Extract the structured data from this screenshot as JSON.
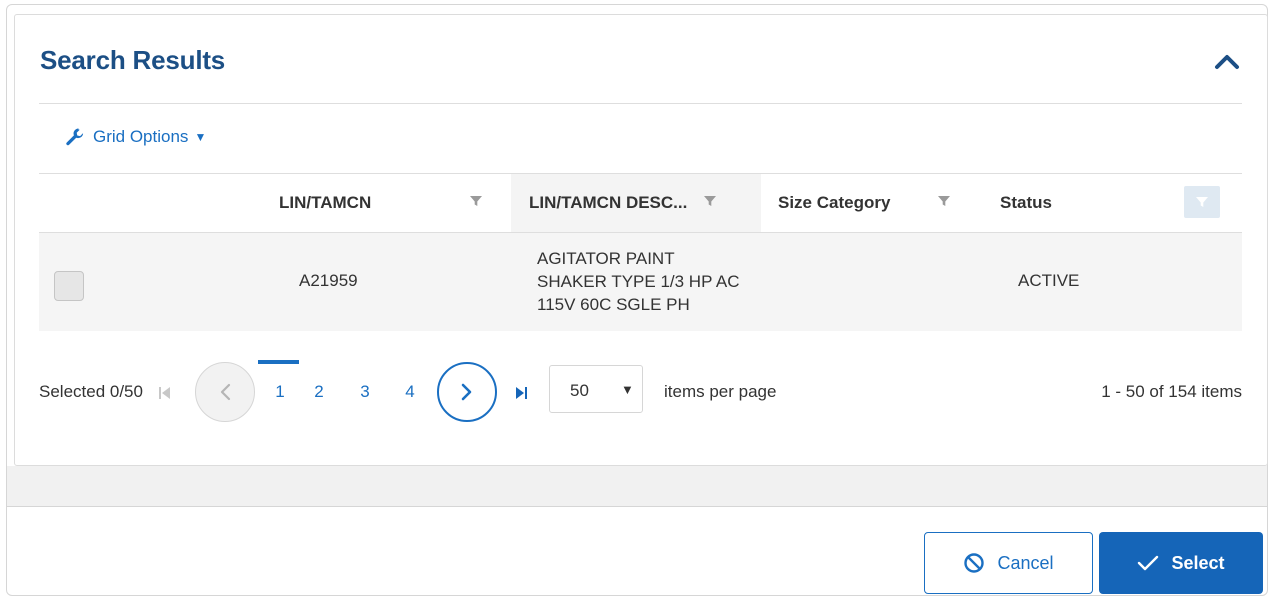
{
  "panel": {
    "title": "Search Results"
  },
  "toolbar": {
    "grid_options_label": "Grid Options"
  },
  "grid": {
    "columns": [
      {
        "label": "LIN/TAMCN"
      },
      {
        "label": "LIN/TAMCN DESC..."
      },
      {
        "label": "Size Category"
      },
      {
        "label": "Status"
      }
    ],
    "rows": [
      {
        "lin": "A21959",
        "desc_lines": [
          "AGITATOR PAINT",
          "SHAKER TYPE 1/3 HP AC",
          "115V 60C SGLE PH"
        ],
        "size_category": "",
        "status": "ACTIVE"
      }
    ]
  },
  "pager": {
    "selected": "Selected 0/50",
    "pages": [
      "1",
      "2",
      "3",
      "4"
    ],
    "active_page": "1",
    "page_size": "50",
    "per_page_label": "items per page",
    "range": "1 - 50 of 154 items"
  },
  "footer": {
    "cancel_label": "Cancel",
    "select_label": "Select"
  },
  "colors": {
    "title": "#1c4f85",
    "link": "#1a6fc2",
    "primary_button": "#1565b8"
  }
}
